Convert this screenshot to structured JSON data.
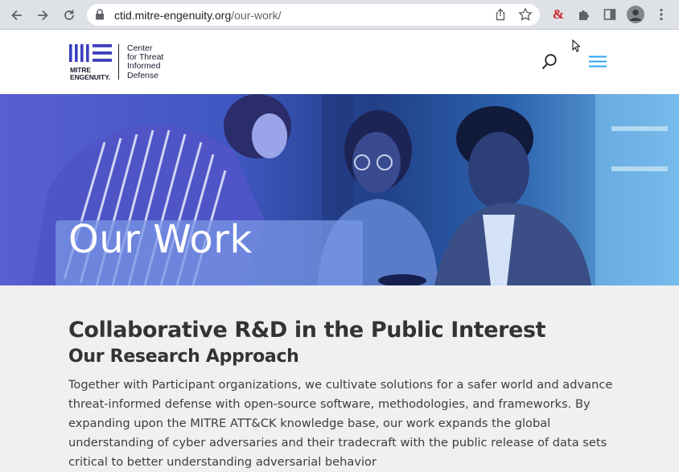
{
  "browser": {
    "url_host": "ctid.mitre-engenuity.org",
    "url_path": "/our-work/",
    "icons": [
      "back-icon",
      "forward-icon",
      "reload-icon",
      "lock-icon",
      "share-icon",
      "star-icon",
      "extension-ampersand-icon",
      "puzzle-icon",
      "sidepanel-icon",
      "profile-icon",
      "kebab-menu-icon"
    ],
    "extension_glyph": "&"
  },
  "site": {
    "logo_brand_line1": "MITRE",
    "logo_brand_line2": "ENGENUITY.",
    "logo_org_line1": "Center",
    "logo_org_line2": "for Threat",
    "logo_org_line3": "Informed",
    "logo_org_line4": "Defense",
    "accent_color": "#3b3fbd",
    "menu_color": "#2ea3f2"
  },
  "hero": {
    "title": "Our Work"
  },
  "main": {
    "heading": "Collaborative R&D in the Public Interest",
    "subheading": "Our Research Approach",
    "paragraph": "Together with Participant organizations, we cultivate solutions for a safer world and advance threat-informed defense with open-source software, methodologies, and frameworks. By expanding upon the MITRE ATT&CK knowledge base, our work expands the global understanding of cyber adversaries and their tradecraft with the public release of data sets critical to better understanding adversarial behavior"
  }
}
